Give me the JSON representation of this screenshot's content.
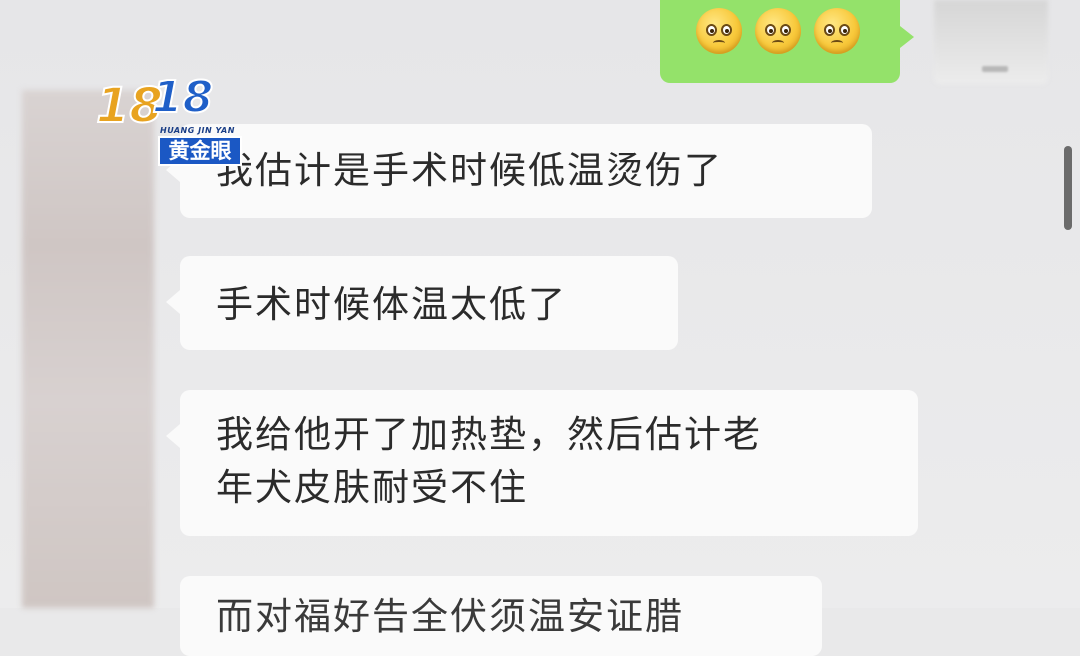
{
  "messages": [
    {
      "side": "right",
      "type": "emoji",
      "emoji_names": [
        "grimacing-face-emoji",
        "grimacing-face-emoji",
        "grimacing-face-emoji"
      ]
    },
    {
      "side": "left",
      "text": "我估计是手术时候低温烫伤了"
    },
    {
      "side": "left",
      "text": "手术时候体温太低了"
    },
    {
      "side": "left",
      "text_line1": "我给他开了加热垫，然后估计老",
      "text_line2": "年犬皮肤耐受不住"
    },
    {
      "side": "left",
      "text": "而对福好告全伏须温安证腊"
    }
  ],
  "watermark": {
    "digits_1": "18",
    "digits_2": "18",
    "subtitle": "HUANG JIN YAN",
    "brand": "黄金眼",
    "colors": {
      "orange": "#e8a320",
      "blue": "#1f5fc8"
    }
  },
  "colors": {
    "bubble_left": "#fafafa",
    "bubble_right": "#94e26a",
    "background": "#e9e9ea"
  }
}
